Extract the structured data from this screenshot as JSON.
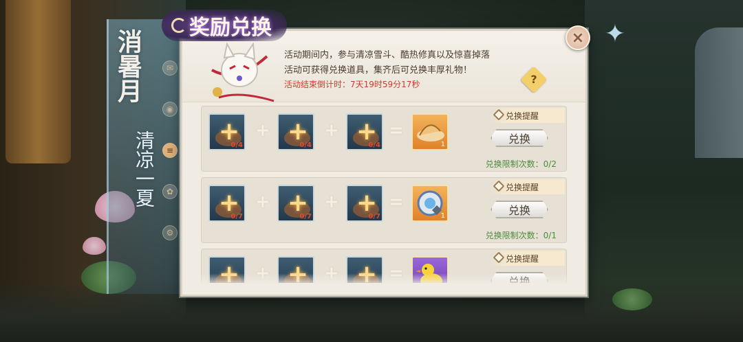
{
  "banner": {
    "title": "消暑月",
    "subtitle": "清凉一夏"
  },
  "panel": {
    "title": "奖励兑换",
    "description": "活动期间内，参与清凉雪斗、酷热修真以及惊喜掉落活动可获得兑换道具，集齐后可兑换丰厚礼物！",
    "countdown": "活动结束倒计时：7天19时59分17秒",
    "help_label": "?",
    "close_label": "×"
  },
  "side_icons": [
    "mail-icon",
    "camera-icon",
    "scroll-icon",
    "creature-icon",
    "gear-icon"
  ],
  "rows": [
    {
      "ingredients": [
        "0/4",
        "0/4",
        "0/4"
      ],
      "reward_qty": "1",
      "reward_icon": "hat-icon",
      "reward_color": "#e69a3c",
      "remind_label": "兑换提醒",
      "button_label": "兑换",
      "limit": "兑换限制次数：0/2"
    },
    {
      "ingredients": [
        "0/7",
        "0/7",
        "0/7"
      ],
      "reward_qty": "1",
      "reward_icon": "disc-icon",
      "reward_color": "#e69a3c",
      "remind_label": "兑换提醒",
      "button_label": "兑换",
      "limit": "兑换限制次数：0/1"
    },
    {
      "ingredients": [
        "",
        "",
        ""
      ],
      "reward_qty": "",
      "reward_icon": "duck-icon",
      "reward_color": "#7a4ab8",
      "remind_label": "兑换提醒",
      "button_label": "兑换",
      "limit": ""
    }
  ],
  "operators": {
    "plus": "+",
    "equals": "="
  }
}
